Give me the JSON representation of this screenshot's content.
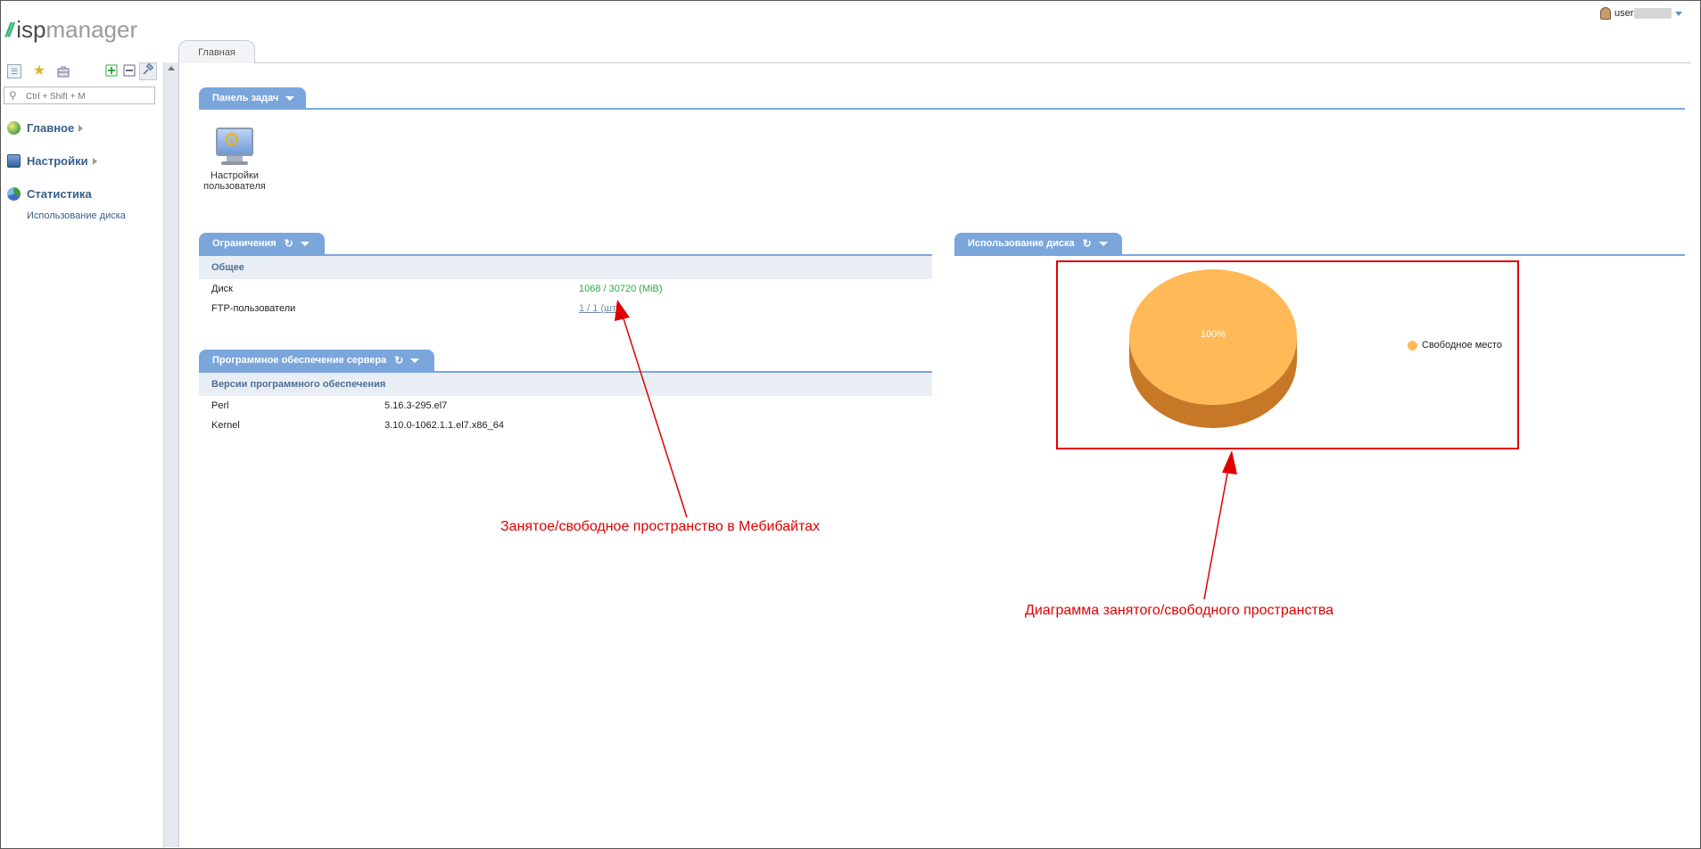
{
  "app": {
    "logo_isp": "isp",
    "logo_manager": "manager"
  },
  "user": {
    "name": "user"
  },
  "sidebar": {
    "search_placeholder": "Ctrl + Shift + M",
    "items": [
      {
        "label": "Главное",
        "icon": "home-globe-icon"
      },
      {
        "label": "Настройки",
        "icon": "settings-monitor-icon"
      },
      {
        "label": "Статистика",
        "icon": "statistics-pie-icon"
      }
    ],
    "sub_item": "Использование диска",
    "toolbar_icons": [
      "tree-view-icon",
      "favorites-star-icon",
      "briefcase-icon",
      "expand-all-icon",
      "collapse-all-icon",
      "pin-icon"
    ]
  },
  "main": {
    "tab_label": "Главная",
    "task_panel": {
      "title": "Панель задач",
      "task_label_line1": "Настройки",
      "task_label_line2": "пользователя"
    },
    "limits": {
      "title": "Ограничения",
      "group": "Общее",
      "rows": [
        {
          "label": "Диск",
          "value": "1068 / 30720 (MiB)"
        },
        {
          "label": "FTP-пользователи",
          "value": "1 / 1 (шт.)"
        }
      ]
    },
    "software": {
      "title": "Программное обеспечение сервера",
      "group": "Версии программного обеспечения",
      "rows": [
        {
          "label": "Perl",
          "value": "5.16.3-295.el7"
        },
        {
          "label": "Kernel",
          "value": "3.10.0-1062.1.1.el7.x86_64"
        }
      ]
    },
    "disk_usage": {
      "title": "Использование диска"
    }
  },
  "chart_data": {
    "type": "pie",
    "categories": [
      "Свободное место"
    ],
    "values": [
      100
    ],
    "data_labels": [
      "100%"
    ],
    "legend": "right",
    "colors": [
      "#ffb957"
    ]
  },
  "annotations": {
    "left": "Занятое/свободное пространство в Мебибайтах",
    "right": "Диаграмма занятого/свободного пространства"
  },
  "colors": {
    "accent": "#7ba6dc",
    "annotation": "#e00000",
    "green_value": "#2aa845",
    "nav_text": "#355e8c"
  }
}
